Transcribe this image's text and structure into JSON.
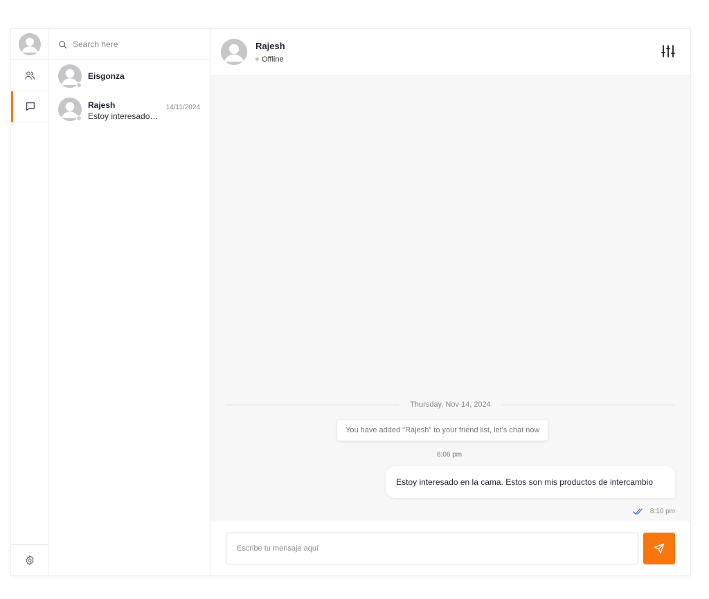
{
  "colors": {
    "accent": "#f7760f",
    "read_tick": "#4a6fd1"
  },
  "icons": {
    "rail_avatar": "user-avatar-icon",
    "contacts": "users-icon",
    "chats": "message-square-icon",
    "settings": "gear-icon",
    "search": "search-icon",
    "filter": "sliders-icon",
    "send": "send-icon",
    "read": "double-check-icon"
  },
  "search": {
    "placeholder": "Search here"
  },
  "chats": [
    {
      "name": "Eisgonza",
      "preview": "",
      "date": ""
    },
    {
      "name": "Rajesh",
      "preview": "Estoy interesado en la cama. Estos son mis productos de intercambio",
      "date": "14/11/2024"
    }
  ],
  "header": {
    "name": "Rajesh",
    "status": "Offline"
  },
  "conversation": {
    "date_separator": "Thursday, Nov 14, 2024",
    "system_message": "You have added \"Rajesh\" to your friend list, let's chat now",
    "system_time": "6:06 pm",
    "message_text": "Estoy interesado en la cama. Estos son mis productos de intercambio",
    "message_time": "8:10 pm"
  },
  "composer": {
    "placeholder": "Escribe tu mensaje aquí"
  }
}
